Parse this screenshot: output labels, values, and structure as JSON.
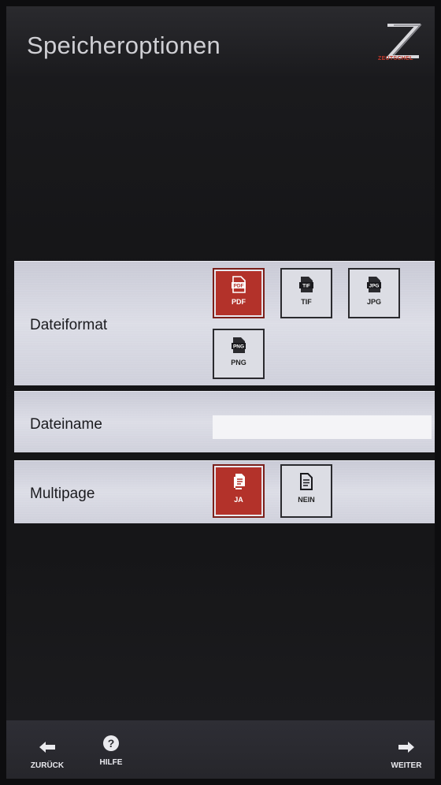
{
  "header": {
    "title": "Speicheroptionen",
    "brand": "ZEUTSCHEL"
  },
  "rows": {
    "format": {
      "label": "Dateiformat",
      "selected": "PDF",
      "options": [
        {
          "label": "PDF",
          "icon_text": "PDF"
        },
        {
          "label": "TIF",
          "icon_text": "TIF"
        },
        {
          "label": "JPG",
          "icon_text": "JPG"
        },
        {
          "label": "PNG",
          "icon_text": "PNG"
        }
      ]
    },
    "filename": {
      "label": "Dateiname",
      "value": "",
      "placeholder": ""
    },
    "multipage": {
      "label": "Multipage",
      "selected": "JA",
      "options": [
        {
          "label": "JA"
        },
        {
          "label": "NEIN"
        }
      ]
    }
  },
  "footer": {
    "back_label": "ZURÜCK",
    "help_label": "HILFE",
    "next_label": "WEITER"
  },
  "colors": {
    "accent_selected": "#b3322a",
    "brand_red": "#c0392b",
    "background": "#161618",
    "panel": "#d6d7e0"
  }
}
